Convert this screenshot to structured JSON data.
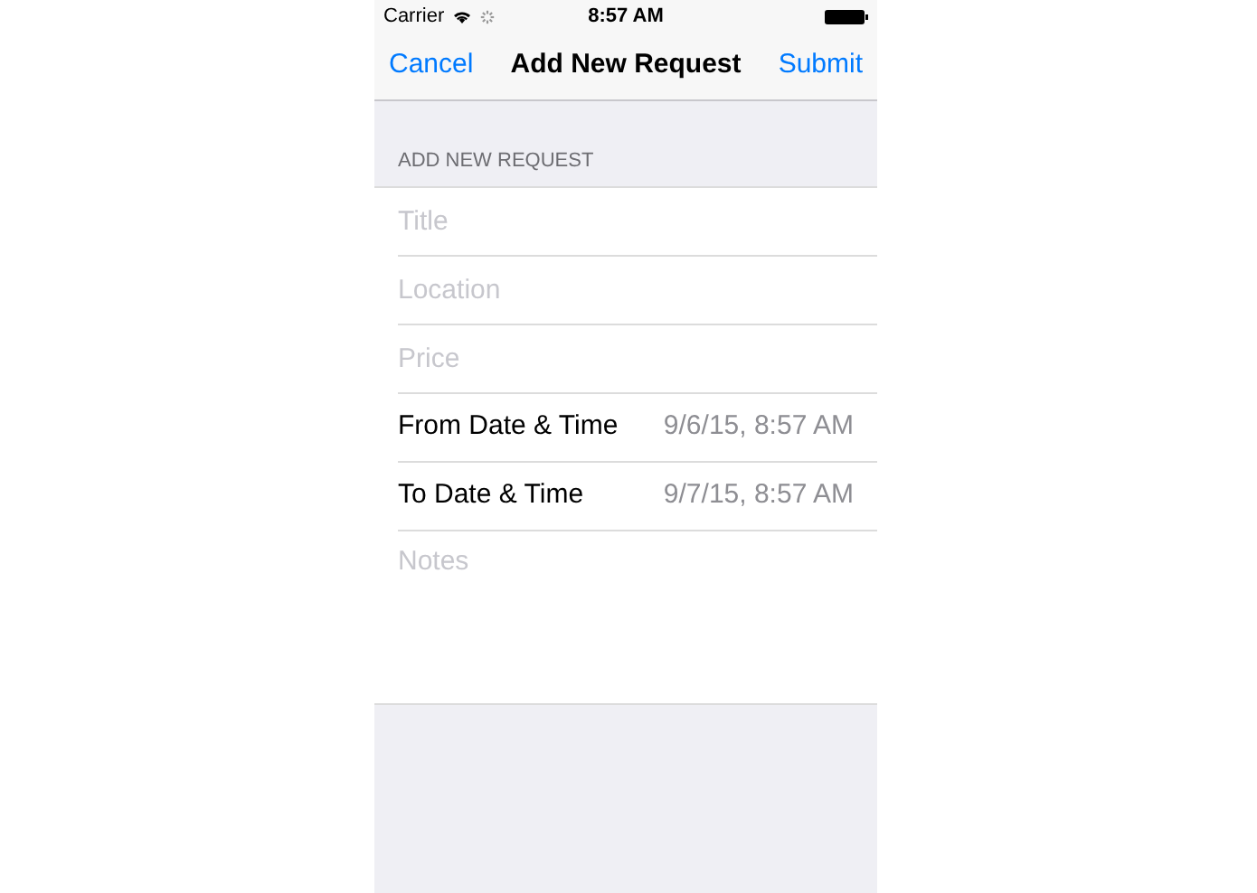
{
  "status_bar": {
    "carrier": "Carrier",
    "time": "8:57 AM"
  },
  "nav_bar": {
    "left_button": "Cancel",
    "title": "Add New Request",
    "right_button": "Submit"
  },
  "section": {
    "header": "ADD NEW REQUEST",
    "rows": [
      {
        "kind": "field",
        "placeholder": "Title"
      },
      {
        "kind": "field",
        "placeholder": "Location"
      },
      {
        "kind": "field",
        "placeholder": "Price"
      },
      {
        "kind": "date",
        "label": "From Date & Time",
        "value": "9/6/15, 8:57 AM"
      },
      {
        "kind": "date",
        "label": "To Date & Time",
        "value": "9/7/15, 8:57 AM"
      },
      {
        "kind": "notes",
        "placeholder": "Notes"
      }
    ]
  }
}
